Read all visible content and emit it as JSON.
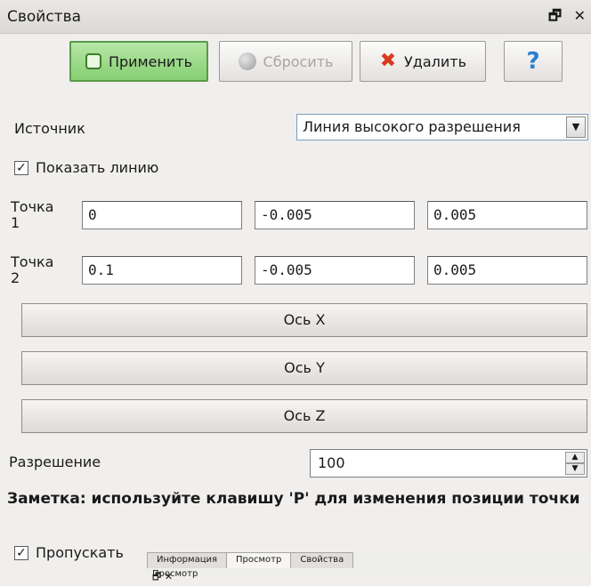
{
  "panel": {
    "title": "Свойства",
    "dock_icons": "🗗 ✕"
  },
  "toolbar": {
    "apply": "Применить",
    "reset": "Сбросить",
    "delete": "Удалить",
    "help": "?"
  },
  "source": {
    "label": "Источник",
    "value": "Линия высокого разрешения"
  },
  "show_line": {
    "label": "Показать линию",
    "checked": true
  },
  "point1": {
    "label": "Точка 1",
    "x": "0",
    "y": "-0.005",
    "z": "0.005"
  },
  "point2": {
    "label": "Точка 2",
    "x": "0.1",
    "y": "-0.005",
    "z": "0.005"
  },
  "axes": {
    "x": "Ось X",
    "y": "Ось Y",
    "z": "Ось Z"
  },
  "resolution": {
    "label": "Разрешение",
    "value": "100"
  },
  "note": "Заметка: используйте клавишу 'P' для изменения позиции точки",
  "skip": {
    "label": "Пропускать",
    "checked": true
  },
  "bottom_tabs": [
    "Информация",
    "Просмотр",
    "Свойства"
  ],
  "bottom_panel_title": "Просмотр",
  "colors": {
    "apply_bg": "#8fd37c",
    "delete_icon": "#d83a1f",
    "help_icon": "#2a7fd0"
  }
}
